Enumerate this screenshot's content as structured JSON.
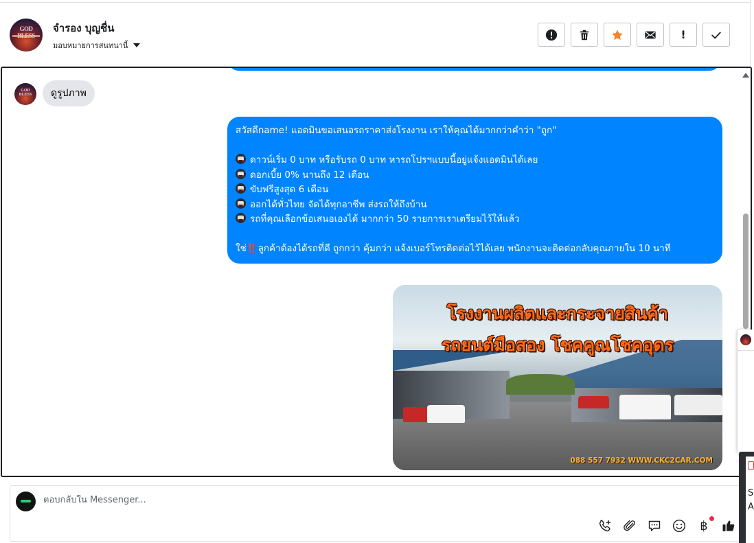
{
  "header": {
    "contact_name": "จำรอง บุญชื่น",
    "assign_label": "มอบหมายการสนทนานี้",
    "avatar_text": "GOD BLESS"
  },
  "actions": [
    {
      "name": "spam-button",
      "icon": "alert-circle-icon"
    },
    {
      "name": "delete-button",
      "icon": "trash-icon"
    },
    {
      "name": "star-button",
      "icon": "star-icon",
      "color": "#f5822a"
    },
    {
      "name": "mark-unread-button",
      "icon": "envelope-icon"
    },
    {
      "name": "follow-up-button",
      "icon": "exclamation-icon",
      "label": "!"
    },
    {
      "name": "mark-done-button",
      "icon": "checkmark-icon"
    }
  ],
  "conversation": {
    "incoming_text": "ดูรูปภาพ",
    "outgoing": {
      "line1": "สวัสดีname! แอดมินขอเสนอรถราคาส่งโรงงาน เราให้คุณได้มากกว่าคำว่า \"ถูก\"",
      "bullets": [
        "ดาวน์เริ่ม 0 บาท หรือรับรถ 0 บาท หารถโปรฯแบบนี้อยู่แจ้งแอดมินได้เลย",
        "ดอกเบี้ย 0% นานถึง 12 เดือน",
        "ขับฟรีสูงสุด 6 เดือน",
        "ออกได้ทั่วไทย จัดได้ทุกอาชีพ ส่งรถให้ถึงบ้าน",
        "รถที่คุณเลือกข้อเสนอเองได้ มากกว่า 50 รายการเราเตรียมไว้ให้แล้ว"
      ],
      "closing_prefix": "ใช่",
      "closing_bang": "‼️",
      "closing_text": "ลูกค้าต้องได้รถที่ดี ถูกกว่า คุ้มกว่า แจ้งเบอร์โทรติดต่อไว้ได้เลย พนักงานจะติดต่อกลับคุณภายใน 10 นาที"
    },
    "image": {
      "title_line1": "โรงงานผลิตและกระจายสินค้า",
      "title_line2": "รถยนต์มือสอง โชคคูณโชคอุดร",
      "footer": "088 557 7932 WWW.CKC2CAR.COM"
    }
  },
  "composer": {
    "placeholder": "ตอบกลับใน Messenger...",
    "tools": [
      "phone-add-icon",
      "paperclip-icon",
      "saved-reply-icon",
      "emoji-icon",
      "baht-payment-icon",
      "thumbs-up-icon"
    ],
    "baht_symbol": "฿"
  },
  "edge": {
    "s": "S",
    "a": "A"
  },
  "colors": {
    "accent": "#0084ff",
    "incoming_bubble": "#e4e6eb",
    "star": "#f5822a",
    "like": "#1c1e21"
  }
}
